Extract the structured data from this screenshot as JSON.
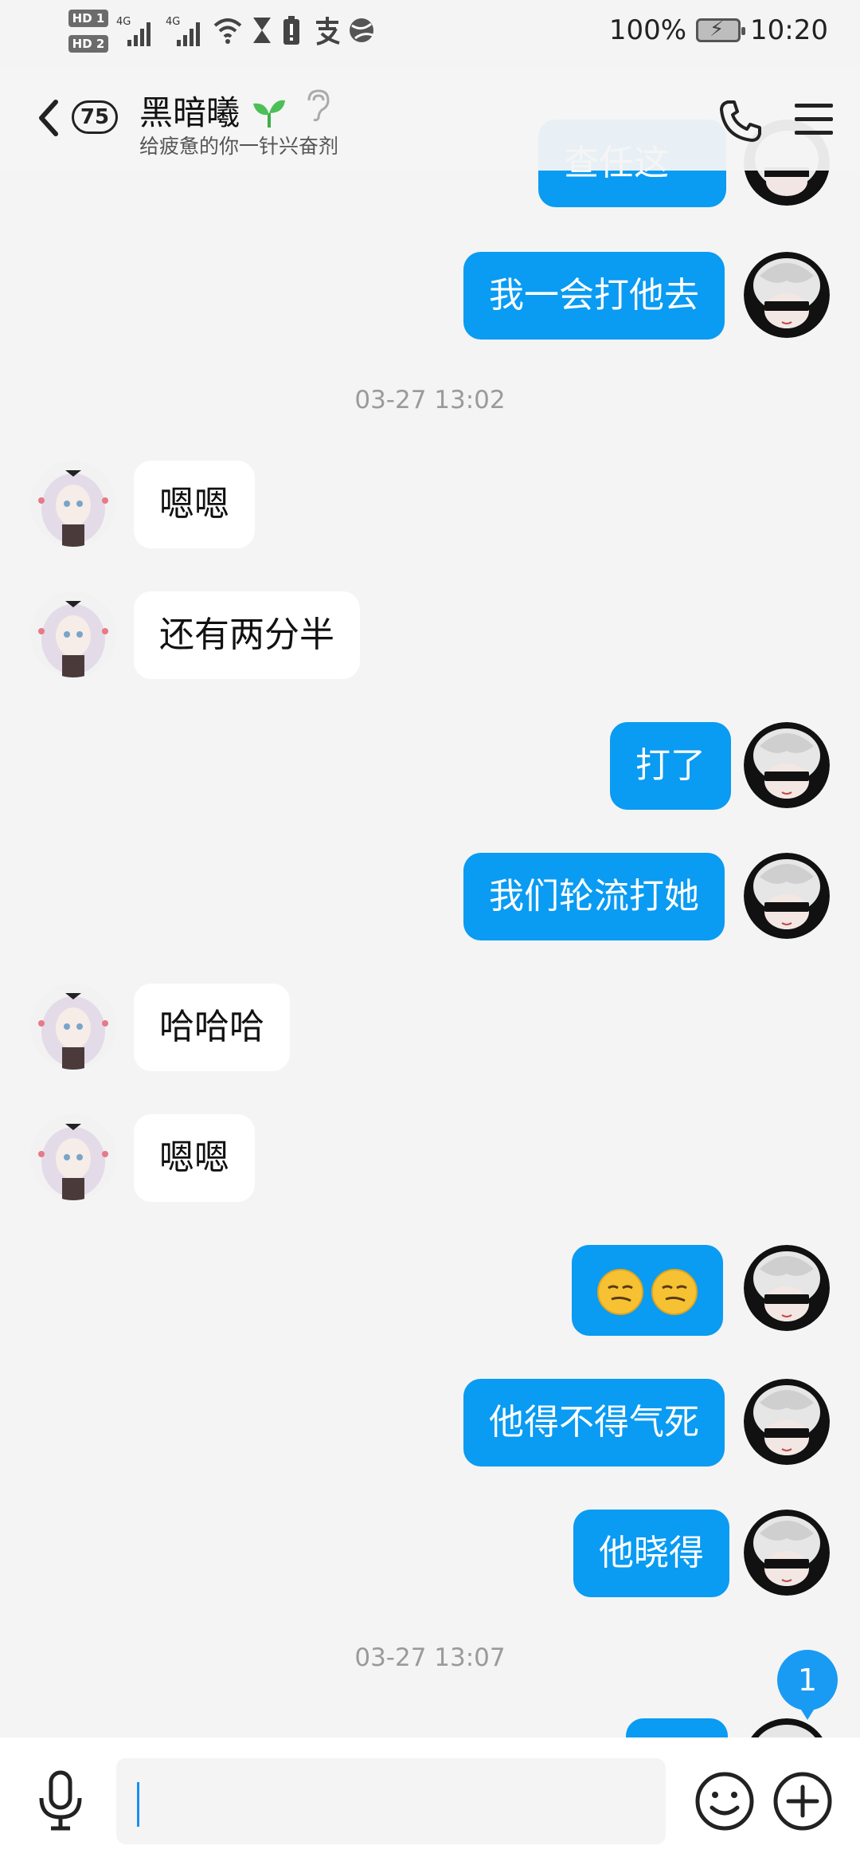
{
  "status_bar": {
    "hd1": "HD 1",
    "hd2": "HD 2",
    "net1": "4G",
    "net2": "4G",
    "battery_percent": "100%",
    "time": "10:20"
  },
  "header": {
    "unread_count": "75",
    "contact_name": "黑暗曦",
    "subtitle": "给疲惫的你一针兴奋剂"
  },
  "messages": [
    {
      "side": "out",
      "text": "查任这"
    },
    {
      "side": "out",
      "text": "我一会打他去"
    },
    {
      "type": "time",
      "text": "03-27 13:02"
    },
    {
      "side": "in",
      "text": "嗯嗯"
    },
    {
      "side": "in",
      "text": "还有两分半"
    },
    {
      "side": "out",
      "text": "打了"
    },
    {
      "side": "out",
      "text": "我们轮流打她"
    },
    {
      "side": "in",
      "text": "哈哈哈"
    },
    {
      "side": "in",
      "text": "嗯嗯"
    },
    {
      "side": "out",
      "text": "",
      "emoji": [
        "smirk-emoji",
        "smirk-emoji"
      ]
    },
    {
      "side": "out",
      "text": "他得不得气死"
    },
    {
      "side": "out",
      "text": "他晓得"
    },
    {
      "type": "time",
      "text": "03-27 13:07"
    }
  ],
  "float_badge": "1",
  "input": {
    "placeholder": ""
  },
  "colors": {
    "out_bubble": "#0a9bf2",
    "in_bubble": "#ffffff",
    "background": "#f4f4f4"
  }
}
